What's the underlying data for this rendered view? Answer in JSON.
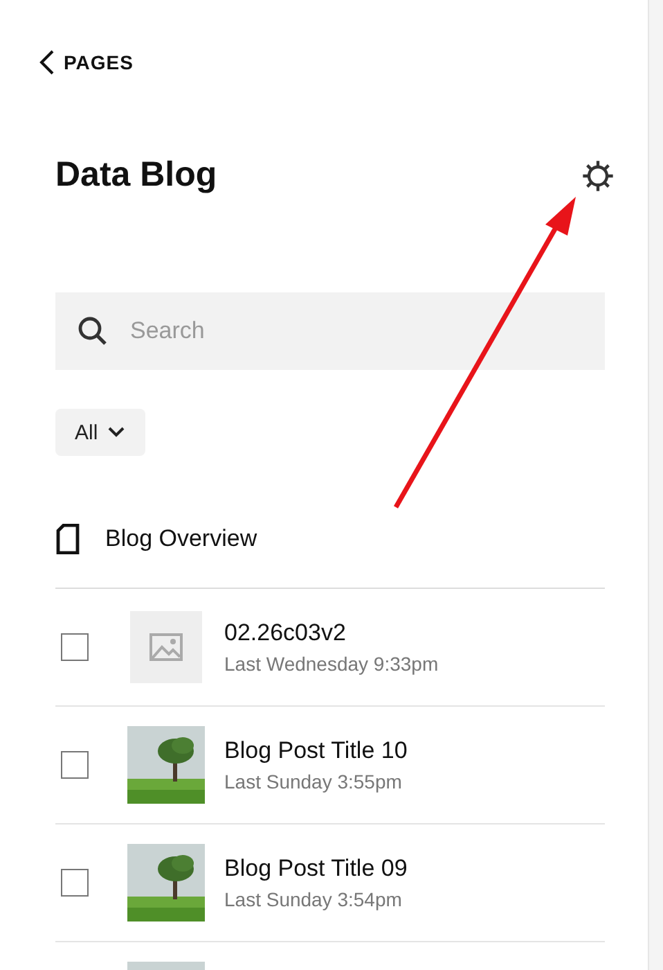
{
  "back_link": {
    "label": "PAGES"
  },
  "header": {
    "title": "Data Blog"
  },
  "search": {
    "placeholder": "Search"
  },
  "filter": {
    "label": "All"
  },
  "overview": {
    "label": "Blog Overview"
  },
  "posts": [
    {
      "title": "02.26c03v2",
      "date": "Last Wednesday 9:33pm",
      "checked": false,
      "kind": "placeholder"
    },
    {
      "title": "Blog Post Title 10",
      "date": "Last Sunday 3:55pm",
      "checked": false,
      "kind": "photo"
    },
    {
      "title": "Blog Post Title 09",
      "date": "Last Sunday 3:54pm",
      "checked": false,
      "kind": "photo"
    },
    {
      "kind": "photo"
    }
  ]
}
